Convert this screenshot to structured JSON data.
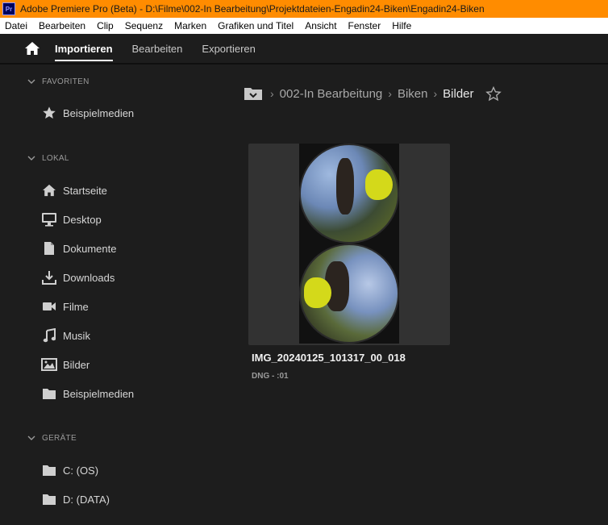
{
  "window": {
    "app_icon_text": "Pr",
    "title": "Adobe Premiere Pro (Beta) - D:\\Filme\\002-In Bearbeitung\\Projektdateien-Engadin24-Biken\\Engadin24-Biken"
  },
  "menu": [
    "Datei",
    "Bearbeiten",
    "Clip",
    "Sequenz",
    "Marken",
    "Grafiken und Titel",
    "Ansicht",
    "Fenster",
    "Hilfe"
  ],
  "workspace": {
    "home_icon": "home-icon",
    "tabs": [
      {
        "label": "Importieren",
        "active": true
      },
      {
        "label": "Bearbeiten",
        "active": false
      },
      {
        "label": "Exportieren",
        "active": false
      }
    ]
  },
  "sidebar": {
    "favoriten": {
      "title": "FAVORITEN",
      "items": [
        {
          "label": "Beispielmedien",
          "icon": "star-icon"
        }
      ]
    },
    "lokal": {
      "title": "LOKAL",
      "items": [
        {
          "label": "Startseite",
          "icon": "home-icon"
        },
        {
          "label": "Desktop",
          "icon": "monitor-icon"
        },
        {
          "label": "Dokumente",
          "icon": "document-icon"
        },
        {
          "label": "Downloads",
          "icon": "download-icon"
        },
        {
          "label": "Filme",
          "icon": "video-camera-icon"
        },
        {
          "label": "Musik",
          "icon": "music-note-icon"
        },
        {
          "label": "Bilder",
          "icon": "image-icon"
        },
        {
          "label": "Beispielmedien",
          "icon": "folder-icon"
        }
      ]
    },
    "geraete": {
      "title": "GERÄTE",
      "items": [
        {
          "label": "C: (OS)",
          "icon": "folder-icon"
        },
        {
          "label": "D: (DATA)",
          "icon": "folder-icon"
        }
      ]
    }
  },
  "breadcrumb": {
    "items": [
      "002-In Bearbeitung",
      "Biken"
    ],
    "current": "Bilder",
    "separator": "›"
  },
  "media": {
    "file_name": "IMG_20240125_101317_00_018",
    "meta": "DNG - :01"
  },
  "colors": {
    "titlebar": "#ff8c00",
    "background": "#1d1d1d",
    "card": "#323232"
  }
}
